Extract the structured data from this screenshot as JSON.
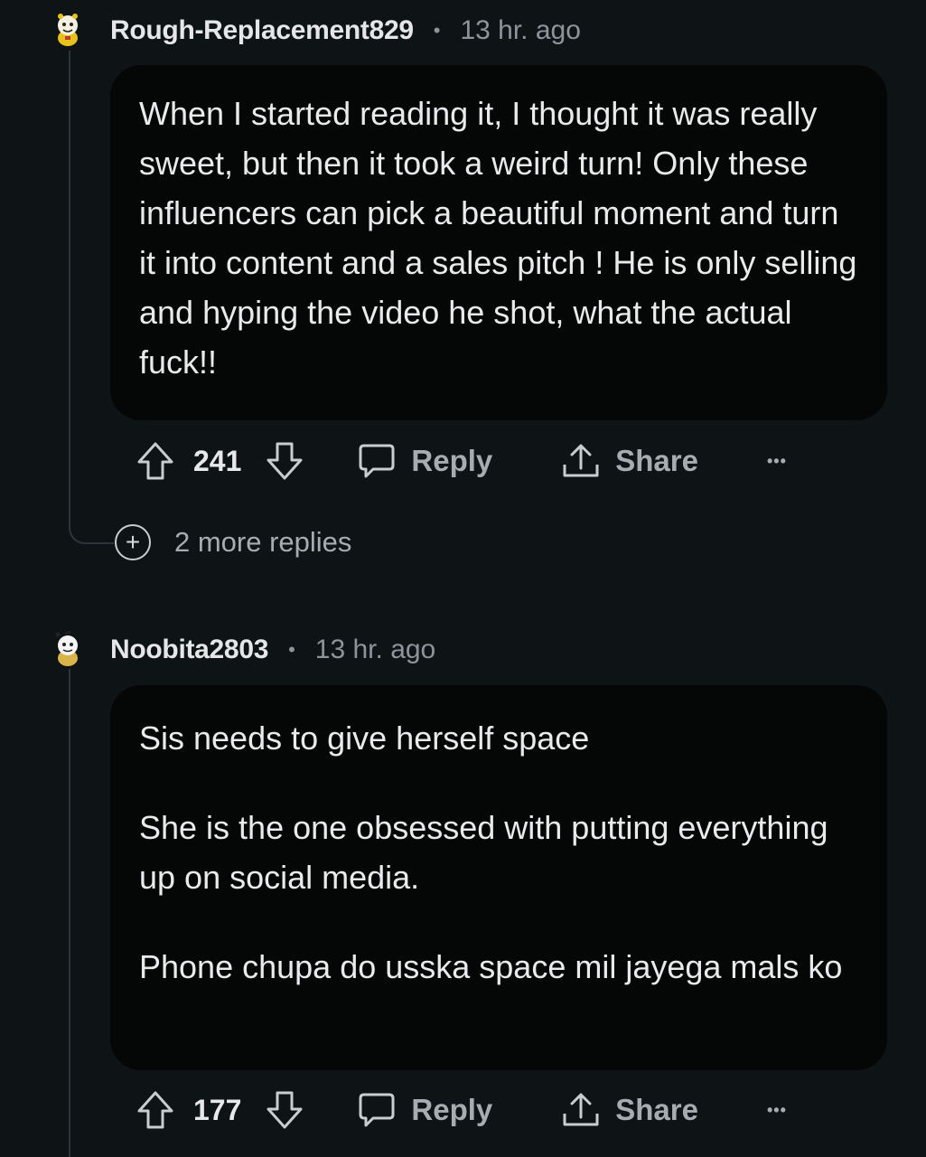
{
  "comments": [
    {
      "username": "Rough-Replacement829",
      "separator": "•",
      "time": "13 hr. ago",
      "paragraphs": [
        "When I started reading it, I thought it was really sweet, but then it took a weird turn! Only these influencers can pick a beautiful moment and turn it into content and a sales pitch ! He is only selling and hyping the video he shot, what the actual fuck!!"
      ],
      "score": "241",
      "reply_label": "Reply",
      "share_label": "Share",
      "more_label": "•••",
      "more_replies": "2 more replies"
    },
    {
      "username": "Noobita2803",
      "separator": "•",
      "time": "13 hr. ago",
      "paragraphs": [
        "Sis needs to give herself space",
        "She is the one obsessed with putting everything up on social media.",
        "Phone chupa do usska space mil jayega mals ko"
      ],
      "score": "177",
      "reply_label": "Reply",
      "share_label": "Share",
      "more_label": "•••"
    }
  ],
  "icons": {
    "upvote": "arrow-up-icon",
    "downvote": "arrow-down-icon",
    "reply": "speech-bubble-icon",
    "share": "share-icon",
    "more": "ellipsis-icon",
    "expand": "plus-circle-icon",
    "avatar": "snoo-avatar-icon"
  },
  "colors": {
    "background": "#0e1416",
    "bubble": "#050606",
    "text": "#e8eaeb",
    "muted": "#8d9599"
  }
}
